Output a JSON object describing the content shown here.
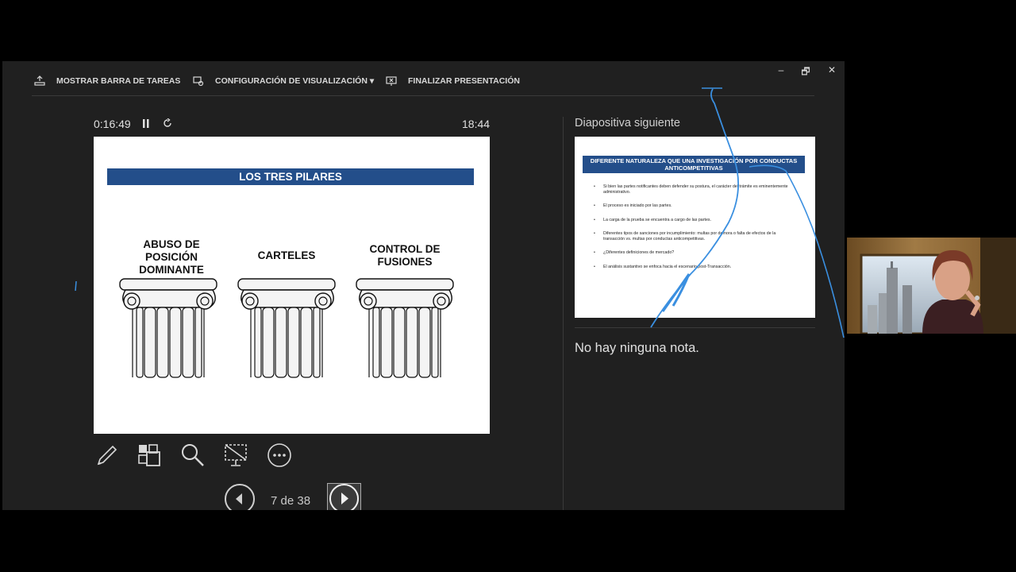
{
  "toolbar": {
    "taskbar_label": "MOSTRAR BARRA DE TAREAS",
    "display_settings_label": "CONFIGURACIÓN DE VISUALIZACIÓN ▾",
    "end_show_label": "FINALIZAR PRESENTACIÓN"
  },
  "window": {
    "minimize": "–",
    "restore": "🗗",
    "close": "✕"
  },
  "timer": {
    "elapsed": "0:16:49",
    "clock": "18:44"
  },
  "current_slide": {
    "title": "LOS TRES PILARES",
    "pillars": [
      {
        "label": "ABUSO DE\nPOSICIÓN\nDOMINANTE"
      },
      {
        "label": "CARTELES"
      },
      {
        "label": "CONTROL DE\nFUSIONES"
      }
    ]
  },
  "navigation": {
    "counter": "7 de 38"
  },
  "next_slide": {
    "heading": "Diapositiva siguiente",
    "title": "DIFERENTE NATURALEZA QUE UNA INVESTIGACIÓN POR CONDUCTAS ANTICOMPETITIVAS",
    "bullets": [
      "Si bien las partes notificantes deben defender su postura, el carácter del trámite es eminentemente administrativo.",
      "El proceso es iniciado por las partes.",
      "La carga de la prueba se encuentra a cargo de las partes.",
      "Diferentes tipos de sanciones por incumplimiento: multas por demora o falta de efectos de la transacción vs. multas por conductas anticompetitivas.",
      "¿Diferentes definiciones de mercado?",
      "El análisis sustantivo se enfoca hacia el escenario post-Transacción."
    ]
  },
  "notes": {
    "text": "No hay ninguna nota."
  },
  "colors": {
    "banner": "#234e8a",
    "panel": "#202020",
    "ink": "#3a8fe0"
  },
  "icons": [
    "taskbar-icon",
    "display-settings-icon",
    "end-show-icon",
    "pause-icon",
    "restart-icon",
    "pen-icon",
    "all-slides-icon",
    "zoom-icon",
    "black-screen-icon",
    "more-options-icon",
    "previous-arrow-icon",
    "next-arrow-icon"
  ]
}
